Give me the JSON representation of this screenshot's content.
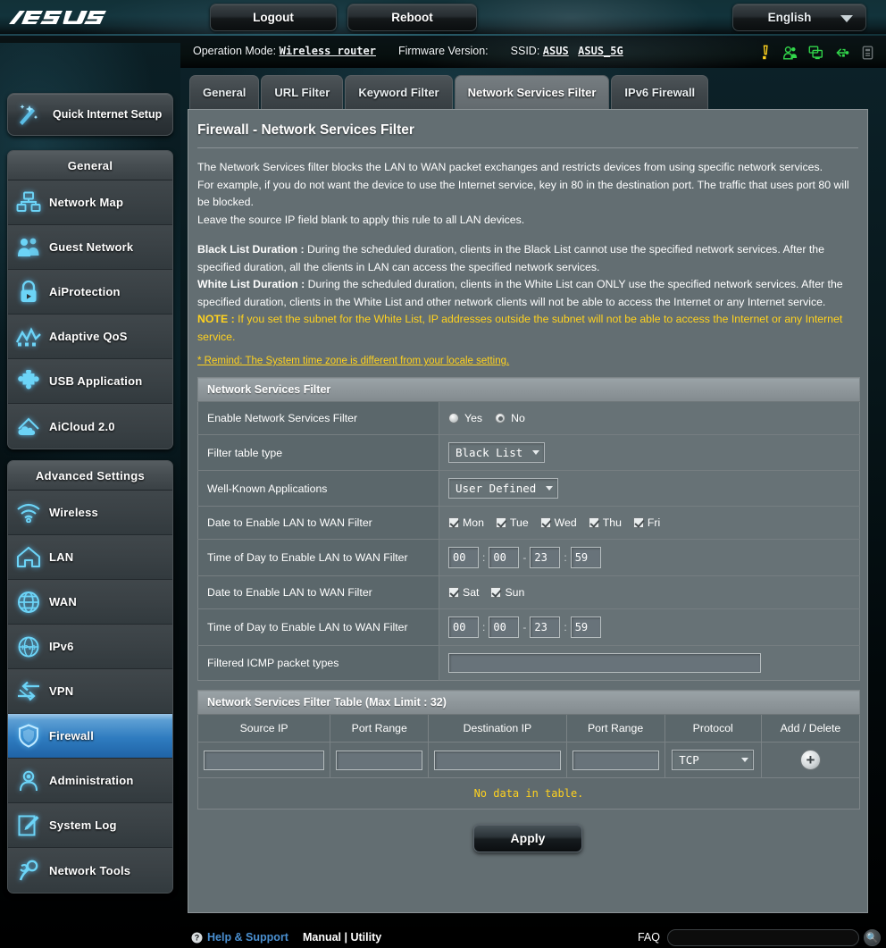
{
  "header": {
    "brand": "/SUS",
    "logout_label": "Logout",
    "reboot_label": "Reboot",
    "language": "English",
    "operation_mode_label": "Operation Mode:",
    "operation_mode_value": "Wireless router",
    "firmware_label": "Firmware Version:",
    "firmware_value": "",
    "ssid_label": "SSID:",
    "ssid_value_1": "ASUS",
    "ssid_value_2": "ASUS_5G",
    "status_icons": [
      {
        "name": "alert-icon",
        "color": "#ffd21e"
      },
      {
        "name": "clients-icon",
        "color": "#32d74b"
      },
      {
        "name": "devices-icon",
        "color": "#32d74b"
      },
      {
        "name": "usb-icon",
        "color": "#32d74b"
      },
      {
        "name": "printer-icon",
        "color": "#6b7274"
      }
    ]
  },
  "sidebar": {
    "quick_internet_setup": "Quick Internet Setup",
    "groups": [
      {
        "title": "General",
        "items": [
          {
            "label": "Network Map",
            "icon": "network-map-icon",
            "active": false
          },
          {
            "label": "Guest Network",
            "icon": "guest-network-icon",
            "active": false
          },
          {
            "label": "AiProtection",
            "icon": "lock-icon",
            "active": false
          },
          {
            "label": "Adaptive QoS",
            "icon": "qos-chart-icon",
            "active": false
          },
          {
            "label": "USB Application",
            "icon": "puzzle-icon",
            "active": false
          },
          {
            "label": "AiCloud 2.0",
            "icon": "cloud-house-icon",
            "active": false
          }
        ]
      },
      {
        "title": "Advanced Settings",
        "items": [
          {
            "label": "Wireless",
            "icon": "wifi-icon",
            "active": false
          },
          {
            "label": "LAN",
            "icon": "house-icon",
            "active": false
          },
          {
            "label": "WAN",
            "icon": "globe-icon",
            "active": false
          },
          {
            "label": "IPv6",
            "icon": "ipv6-globe-icon",
            "active": false
          },
          {
            "label": "VPN",
            "icon": "vpn-arrows-icon",
            "active": false
          },
          {
            "label": "Firewall",
            "icon": "shield-icon",
            "active": true
          },
          {
            "label": "Administration",
            "icon": "person-icon",
            "active": false
          },
          {
            "label": "System Log",
            "icon": "log-pencil-icon",
            "active": false
          },
          {
            "label": "Network Tools",
            "icon": "wrench-icon",
            "active": false
          }
        ]
      }
    ]
  },
  "tabs": [
    {
      "label": "General",
      "active": false
    },
    {
      "label": "URL Filter",
      "active": false
    },
    {
      "label": "Keyword Filter",
      "active": false
    },
    {
      "label": "Network Services Filter",
      "active": true
    },
    {
      "label": "IPv6 Firewall",
      "active": false
    }
  ],
  "page": {
    "title": "Firewall - Network Services Filter",
    "description": [
      "The Network Services filter blocks the LAN to WAN packet exchanges and restricts devices from using specific network services.",
      "For example, if you do not want the device to use the Internet service, key in 80 in the destination port. The traffic that uses port 80 will be blocked.",
      "Leave the source IP field blank to apply this rule to all LAN devices."
    ],
    "black_list_label": "Black List Duration :",
    "black_list_text": " During the scheduled duration, clients in the Black List cannot use the specified network services. After the specified duration, all the clients in LAN can access the specified network services.",
    "white_list_label": "White List Duration :",
    "white_list_text": " During the scheduled duration, clients in the White List can ONLY use the specified network services. After the specified duration, clients in the White List and other network clients will not be able to access the Internet or any Internet service.",
    "note_label": "NOTE :",
    "note_text": " If you set the subnet for the White List, IP addresses outside the subnet will not be able to access the Internet or any Internet service.",
    "remind": "* Remind: The System time zone is different from your locale setting."
  },
  "form": {
    "section_title": "Network Services Filter",
    "enable_label": "Enable Network Services Filter",
    "enable_yes": "Yes",
    "enable_no": "No",
    "enable_value": "No",
    "filter_table_type_label": "Filter table type",
    "filter_table_type_value": "Black List",
    "well_known_label": "Well-Known Applications",
    "well_known_value": "User Defined",
    "date_label_1": "Date to Enable LAN to WAN Filter",
    "days_weekday": [
      {
        "label": "Mon",
        "checked": true
      },
      {
        "label": "Tue",
        "checked": true
      },
      {
        "label": "Wed",
        "checked": true
      },
      {
        "label": "Thu",
        "checked": true
      },
      {
        "label": "Fri",
        "checked": true
      }
    ],
    "time_label_1": "Time of Day to Enable LAN to WAN Filter",
    "time_1": {
      "start_h": "00",
      "start_m": "00",
      "end_h": "23",
      "end_m": "59",
      "dash": "-",
      "colon": ":"
    },
    "date_label_2": "Date to Enable LAN to WAN Filter",
    "days_weekend": [
      {
        "label": "Sat",
        "checked": true
      },
      {
        "label": "Sun",
        "checked": true
      }
    ],
    "time_label_2": "Time of Day to Enable LAN to WAN Filter",
    "time_2": {
      "start_h": "00",
      "start_m": "00",
      "end_h": "23",
      "end_m": "59",
      "dash": "-",
      "colon": ":"
    },
    "icmp_label": "Filtered ICMP packet types",
    "icmp_value": ""
  },
  "filter_table": {
    "section_title": "Network Services Filter Table (Max Limit : 32)",
    "columns": [
      "Source IP",
      "Port Range",
      "Destination IP",
      "Port Range",
      "Protocol",
      "Add / Delete"
    ],
    "new_row": {
      "source_ip": "",
      "port_range_src": "",
      "destination_ip": "",
      "port_range_dst": "",
      "protocol": "TCP",
      "add_symbol": "+"
    },
    "empty_message": "No data in table."
  },
  "actions": {
    "apply_label": "Apply"
  },
  "footer": {
    "help_support": "Help & Support",
    "manual_utility": "Manual | Utility",
    "faq": "FAQ",
    "search_value": ""
  },
  "colors": {
    "accent_blue": "#2f7cc0",
    "note_yellow": "#ffd21e",
    "panel_gray": "#636e72",
    "row_label": "#5b676b",
    "row_value": "#677276"
  }
}
